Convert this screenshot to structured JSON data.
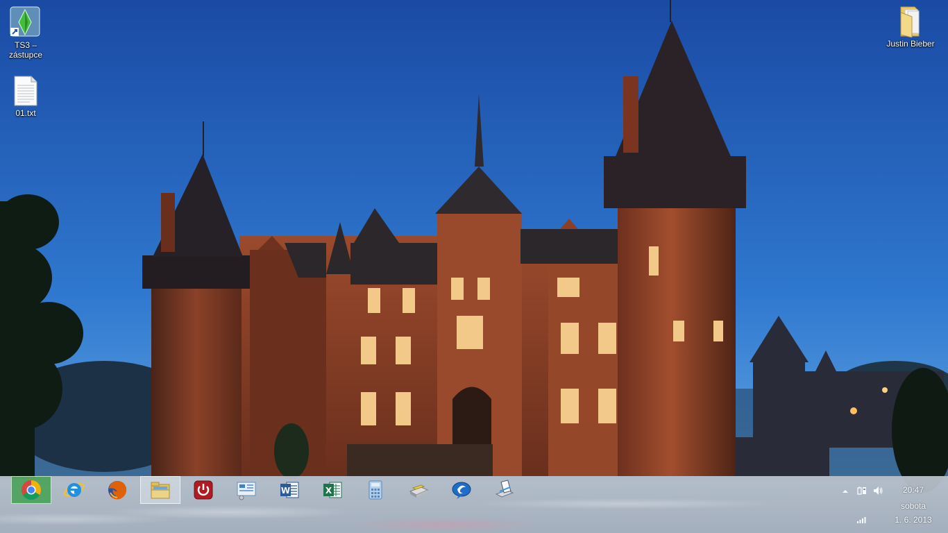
{
  "desktop": {
    "icons": [
      {
        "label": "TS3 –\nzástupce",
        "icon": "sims3-shortcut-icon"
      },
      {
        "label": "01.txt",
        "icon": "text-file-icon"
      },
      {
        "label": "Justin Bieber",
        "icon": "folder-icon"
      }
    ],
    "wallpaper": "castle-de-haar-dusk"
  },
  "taskbar": {
    "pinned": [
      {
        "name": "Google Chrome",
        "icon": "chrome-icon",
        "state": "active"
      },
      {
        "name": "Internet Explorer",
        "icon": "internet-explorer-icon",
        "state": "normal"
      },
      {
        "name": "Mozilla Firefox",
        "icon": "firefox-icon",
        "state": "normal"
      },
      {
        "name": "File Explorer",
        "icon": "file-explorer-icon",
        "state": "active"
      },
      {
        "name": "Shutdown",
        "icon": "power-icon",
        "state": "normal"
      },
      {
        "name": "Control Panel",
        "icon": "control-panel-icon",
        "state": "normal"
      },
      {
        "name": "Microsoft Word",
        "icon": "word-icon",
        "state": "normal"
      },
      {
        "name": "Microsoft Excel",
        "icon": "excel-icon",
        "state": "normal"
      },
      {
        "name": "Calculator",
        "icon": "calculator-icon",
        "state": "normal"
      },
      {
        "name": "Scanner",
        "icon": "scanner-icon",
        "state": "normal"
      },
      {
        "name": "Cyberlink",
        "icon": "cyberlink-icon",
        "state": "normal"
      },
      {
        "name": "Scan to Document",
        "icon": "scan-document-icon",
        "state": "normal"
      }
    ]
  },
  "tray": {
    "icons": [
      "show-hidden-icons-chevron",
      "power-battery-icon",
      "speaker-icon",
      "signal-bars-icon"
    ],
    "clock": {
      "time": "20:47",
      "day": "sobota",
      "date": "1. 6. 2013"
    }
  },
  "colors": {
    "sky_top": "#1a4ea8",
    "sky_bottom": "#3d8ed8",
    "brick": "#7a3a22",
    "taskbar": "#a9b2bd"
  }
}
